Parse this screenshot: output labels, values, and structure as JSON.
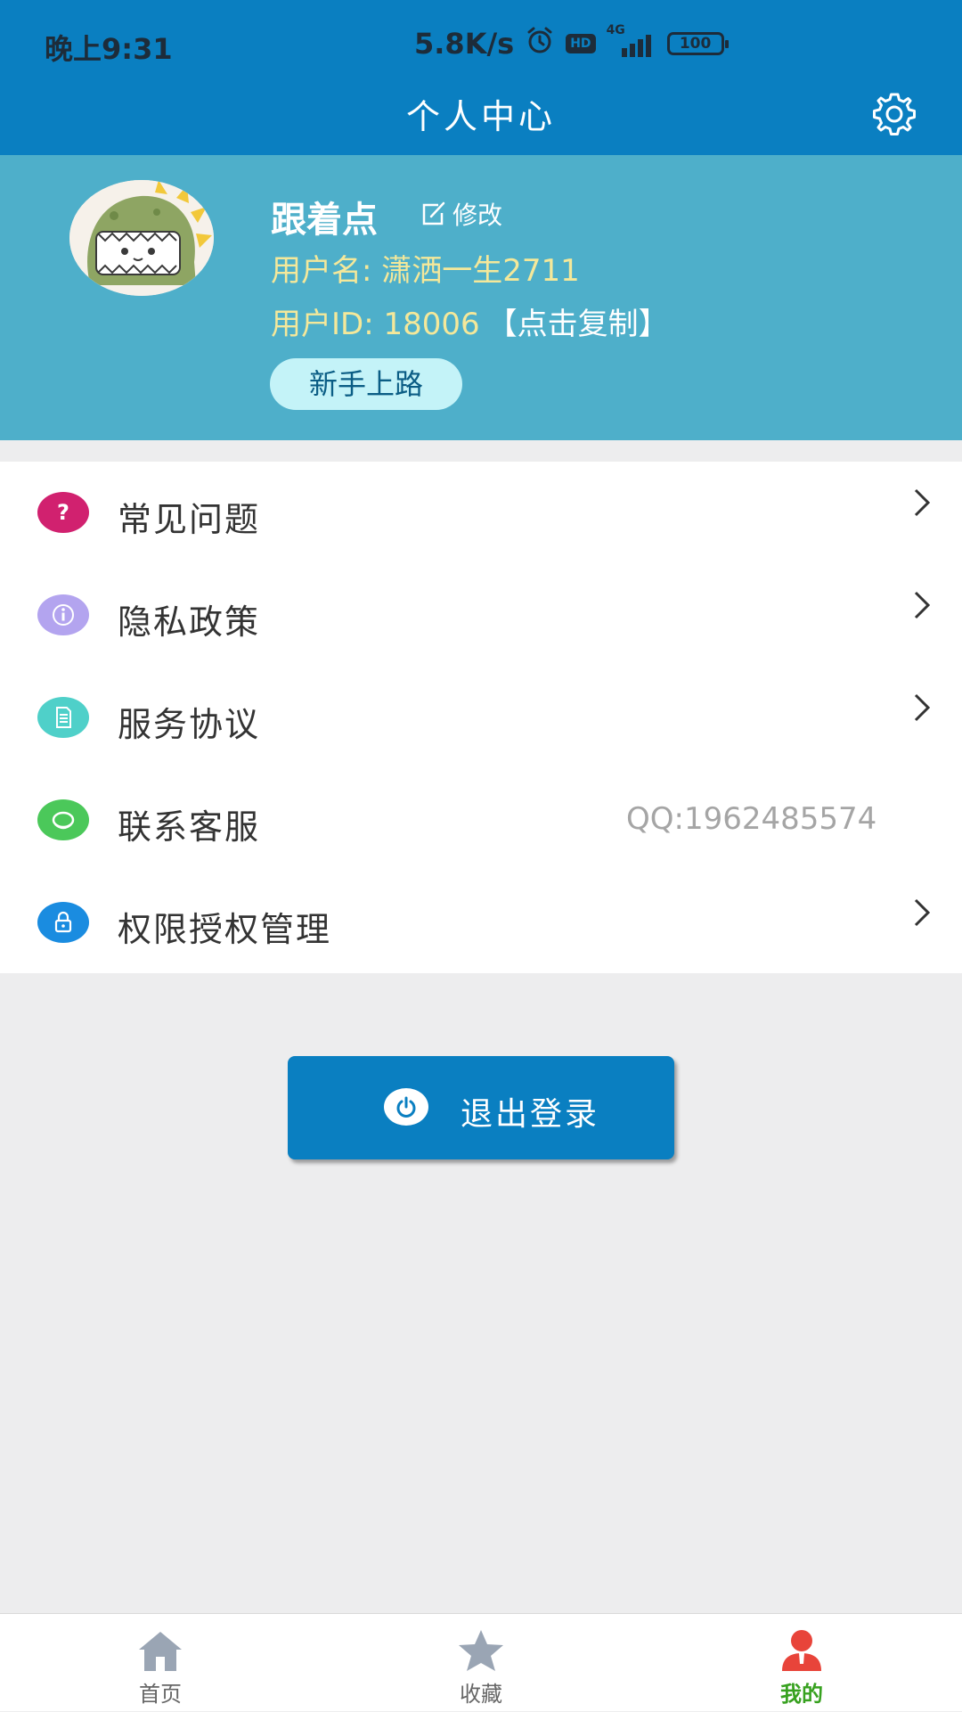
{
  "status_bar": {
    "time": "晚上9:31",
    "net_speed": "5.8K/s",
    "hd": "HD",
    "network": "4G",
    "battery": "100"
  },
  "header": {
    "title": "个人中心",
    "settings_icon": "gear-icon"
  },
  "profile": {
    "nickname": "跟着点",
    "edit_label": "修改",
    "username": "用户名: 潇洒一生2711",
    "user_id": "用户ID: 18006",
    "copy_label": "【点击复制】",
    "level_badge": "新手上路"
  },
  "menu": {
    "items": [
      {
        "label": "常见问题",
        "icon": "question-icon",
        "color": "#d1216f"
      },
      {
        "label": "隐私政策",
        "icon": "info-icon",
        "color": "#b3a4ef"
      },
      {
        "label": "服务协议",
        "icon": "document-icon",
        "color": "#4fd0c9"
      },
      {
        "label": "联系客服",
        "icon": "headset-icon",
        "color": "#4bc85a",
        "value": "QQ:1962485574"
      },
      {
        "label": "权限授权管理",
        "icon": "lock-icon",
        "color": "#1a8ce0"
      }
    ]
  },
  "logout": {
    "label": "退出登录",
    "icon": "power-icon"
  },
  "bottom_nav": {
    "items": [
      {
        "label": "首页",
        "icon": "home-icon"
      },
      {
        "label": "收藏",
        "icon": "star-icon"
      },
      {
        "label": "我的",
        "icon": "user-icon",
        "active": true
      }
    ]
  },
  "colors": {
    "primary": "#0a7fc1",
    "profile_bg": "#4eafca",
    "highlight_text": "#f4e89a",
    "active_tab": "#37a11f"
  }
}
